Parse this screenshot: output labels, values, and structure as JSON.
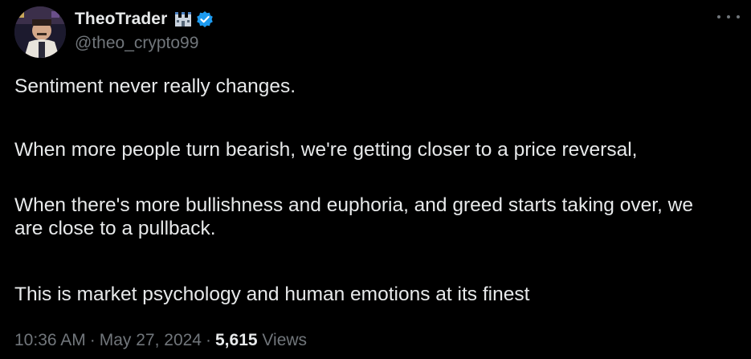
{
  "author": {
    "display_name": "TheoTrader",
    "handle": "@theo_crypto99",
    "badge_icon": "castle-icon",
    "verified_icon": "verified-badge-icon",
    "verified_color": "#1d9bf0"
  },
  "more_menu": {
    "icon": "more-horizontal-icon"
  },
  "tweet": {
    "paragraphs": [
      "Sentiment never really changes.",
      "When more people turn bearish, we're getting closer to a price reversal,",
      "When there's more bullishness and euphoria, and greed starts taking over, we are close to a pullback.",
      "This is market psychology and human emotions at its finest"
    ]
  },
  "meta": {
    "time": "10:36 AM",
    "separator": "·",
    "date": "May 27, 2024",
    "views_count": "5,615",
    "views_label": "Views"
  },
  "colors": {
    "background": "#000000",
    "text_primary": "#e7e9ea",
    "text_secondary": "#71767b"
  }
}
